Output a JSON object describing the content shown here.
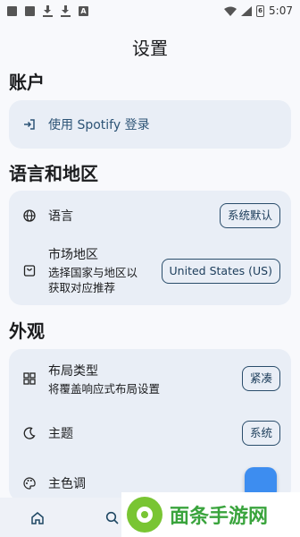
{
  "status_bar": {
    "time": "5:07",
    "battery_label": "6"
  },
  "page_title": "设置",
  "account": {
    "heading": "账户",
    "login_label": "使用 Spotify 登录"
  },
  "language_region": {
    "heading": "语言和地区",
    "language_label": "语言",
    "language_value": "系统默认",
    "market_label": "市场地区",
    "market_desc_line1": "选择国家与地区以",
    "market_desc_line2": "获取对应推荐",
    "market_value": "United States (US)"
  },
  "appearance": {
    "heading": "外观",
    "layout_label": "布局类型",
    "layout_desc": "将覆盖响应式布局设置",
    "layout_value": "紧凑",
    "theme_label": "主题",
    "theme_value": "系统",
    "color_label": "主色调",
    "color_value": "#3d8df0"
  },
  "watermark": {
    "text": "面条手游网"
  },
  "icons": {
    "login": "login-icon",
    "language": "globe-icon",
    "market": "shopping-bag-icon",
    "layout": "grid-icon",
    "theme": "moon-icon",
    "color": "palette-icon",
    "nav_home": "home-icon",
    "nav_search": "search-icon"
  }
}
